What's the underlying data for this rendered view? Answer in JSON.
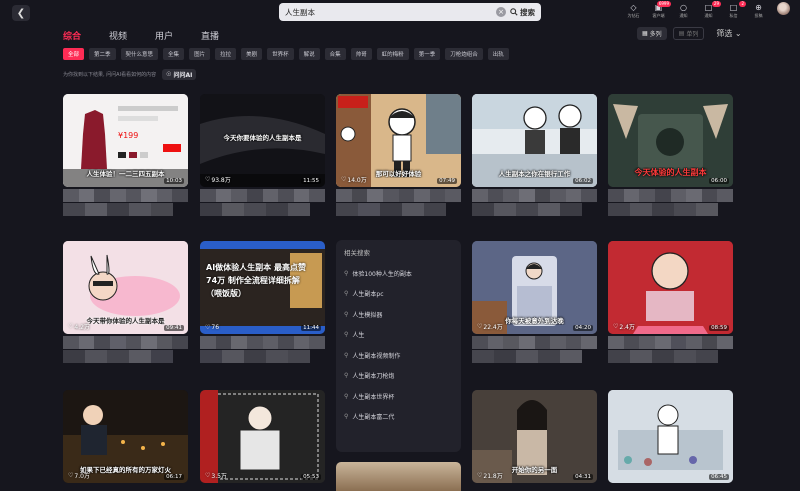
{
  "header": {
    "back_icon": "arrow-left-icon",
    "search_value": "人生副本",
    "search_button": "搜索",
    "top_icons": [
      {
        "icon": "diamond-icon",
        "label": "为钻石",
        "badge": ""
      },
      {
        "icon": "cart-icon",
        "label": "客户端",
        "badge": "6999"
      },
      {
        "icon": "chat-icon",
        "label": "通知",
        "badge": ""
      },
      {
        "icon": "message-icon",
        "label": "通知",
        "badge": "29"
      },
      {
        "icon": "message-alt-icon",
        "label": "私信",
        "badge": "2"
      },
      {
        "icon": "upload-icon",
        "label": "投稿",
        "badge": ""
      }
    ]
  },
  "tabs": [
    {
      "label": "综合",
      "active": true
    },
    {
      "label": "视频",
      "active": false
    },
    {
      "label": "用户",
      "active": false
    },
    {
      "label": "直播",
      "active": false
    }
  ],
  "view": {
    "grid_label": "多列",
    "single_label": "单列",
    "filter_label": "筛选"
  },
  "chips": [
    {
      "label": "全部",
      "active": true
    },
    {
      "label": "第二季",
      "active": false
    },
    {
      "label": "契什么意思",
      "active": false
    },
    {
      "label": "全集",
      "active": false
    },
    {
      "label": "图片",
      "active": false
    },
    {
      "label": "拉拉",
      "active": false
    },
    {
      "label": "美剧",
      "active": false
    },
    {
      "label": "世界杯",
      "active": false
    },
    {
      "label": "解说",
      "active": false
    },
    {
      "label": "合集",
      "active": false
    },
    {
      "label": "帅哥",
      "active": false
    },
    {
      "label": "虹的梅粉",
      "active": false
    },
    {
      "label": "第一季",
      "active": false
    },
    {
      "label": "刀枪炮组合",
      "active": false
    },
    {
      "label": "出轨",
      "active": false
    }
  ],
  "ai": {
    "hint": "为你找到以下结果, 问问AI看看如何的内容",
    "button_label": "问问AI"
  },
  "cards": [
    {
      "caption": "人生体验！一二三四五副本",
      "likes": "",
      "duration": "10:03"
    },
    {
      "caption": "今天你要体验的人生副本是",
      "likes": "93.8万",
      "duration": "11:55"
    },
    {
      "caption": "那可以好好体验",
      "likes": "14.0万",
      "duration": "07:49"
    },
    {
      "caption": "人生副本之你在银行工作",
      "likes": "",
      "duration": "06:02"
    },
    {
      "caption": "今天体验的人生副本",
      "likes": "",
      "duration": "06:00"
    },
    {
      "caption": "今天带你体验的人生副本是",
      "likes": "4.2万",
      "duration": "09:41"
    },
    {
      "caption": "AI做体验人生副本 最高点赞74万 制作全流程详细拆解（喂饭版）",
      "likes": "76",
      "duration": "11:44"
    },
    {
      "caption": "你每天被意外到达晚",
      "likes": "22.4万",
      "duration": "04:20"
    },
    {
      "caption": "",
      "likes": "2.4万",
      "duration": "08:59"
    },
    {
      "caption": "如果下已经真的所有的万家灯火",
      "likes": "7.0万",
      "duration": "06:17"
    },
    {
      "caption": "",
      "likes": "3.5万",
      "duration": "05:53"
    },
    {
      "caption": "开始你的另一面",
      "likes": "21.8万",
      "duration": "04:31"
    },
    {
      "caption": "",
      "likes": "",
      "duration": "06:45"
    }
  ],
  "related": {
    "title": "相关搜索",
    "items": [
      "体验100种人生的副本",
      "人生副本pc",
      "人生模拟器",
      "人生",
      "人生副本视频制作",
      "人生副本刀枪炮",
      "人生副本世界杯",
      "人生副本富二代"
    ]
  },
  "colors": {
    "accent": "#fe2c55",
    "background": "#16161e",
    "panel": "#22222b"
  }
}
